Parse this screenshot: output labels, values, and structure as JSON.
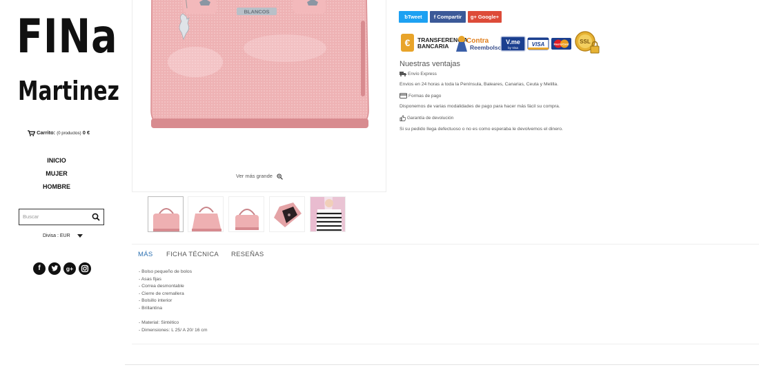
{
  "brand": {
    "line1": "FINa",
    "line2": "Martinez"
  },
  "cart": {
    "label": "Carrito:",
    "count": "(0 productos)",
    "total": "0 €"
  },
  "nav": {
    "items": [
      "INICIO",
      "MUJER",
      "HOMBRE"
    ]
  },
  "search": {
    "placeholder": "Buscar"
  },
  "currency": {
    "label": "Divisa : EUR"
  },
  "social": {
    "icons": [
      "facebook-icon",
      "twitter-icon",
      "google-plus-icon",
      "instagram-icon"
    ]
  },
  "product": {
    "view_larger": "Ver más grande",
    "bag_plate_text": "BLANCOS"
  },
  "share": {
    "tweet": "Tweet",
    "share": "Compartir",
    "google": "Google+"
  },
  "payments": {
    "transfer_line1": "TRANSFERENCIA",
    "transfer_line2": "BANCARIA",
    "cod_line1": "Contra",
    "cod_line2": "Reembolso",
    "vme_line1": "V.me",
    "vme_line2": "by Visa",
    "visa": "VISA",
    "mastercard": "MasterCard",
    "ssl": "SSL"
  },
  "advantages": {
    "title": "Nuestras ventajas",
    "items": [
      {
        "title": "Envío Express",
        "text": "Envios en 24 horas a toda la Península, Baleares, Canarias, Ceuta y Melilla."
      },
      {
        "title": "Formas de pago",
        "text": "Disponemos de varias modalidades de pago para hacer más fácil su compra."
      },
      {
        "title": "Garantía de devolución",
        "text": "Si su pedido llega defectuoso o no es como esperaba le devolvemos el dinero."
      }
    ]
  },
  "tabs": [
    "MÁS",
    "FICHA TÉCNICA",
    "RESEÑAS"
  ],
  "description": [
    "- Bolso pequeño de bolos",
    "- Asas fijas",
    "- Correa desmontable",
    "- Cierre de cremallera",
    "- Bolsillo interior",
    "- Brillantina",
    "",
    "- Material: Sintético",
    "- Dimensiones: L 25/ A 20/ 16 cm"
  ],
  "colors": {
    "accent_blue": "#2b6fb1",
    "twitter": "#1da1f2",
    "facebook": "#3b5998",
    "google": "#dd4b39",
    "bag_pink": "#eeb0b2"
  }
}
